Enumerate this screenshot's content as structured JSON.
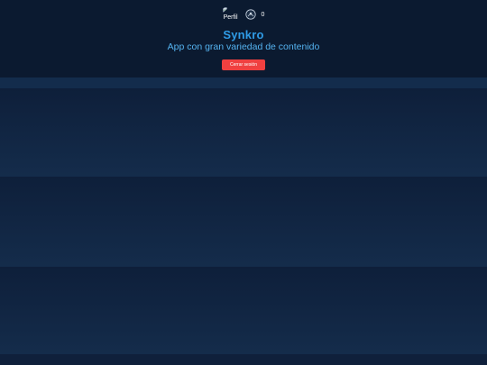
{
  "header": {
    "perfil_label": "Perfil",
    "credits_value": "0",
    "brand": "Synkro",
    "tagline": "App con gran variedad de contenido",
    "logout_label": "Cerrar sesión"
  },
  "icons": {
    "perfil": "broken-image-icon",
    "credits": "coin-icon"
  },
  "colors": {
    "background": "#0d1d36",
    "brand": "#2f9be6",
    "tagline": "#55b3f0",
    "logout": "#f04040"
  }
}
